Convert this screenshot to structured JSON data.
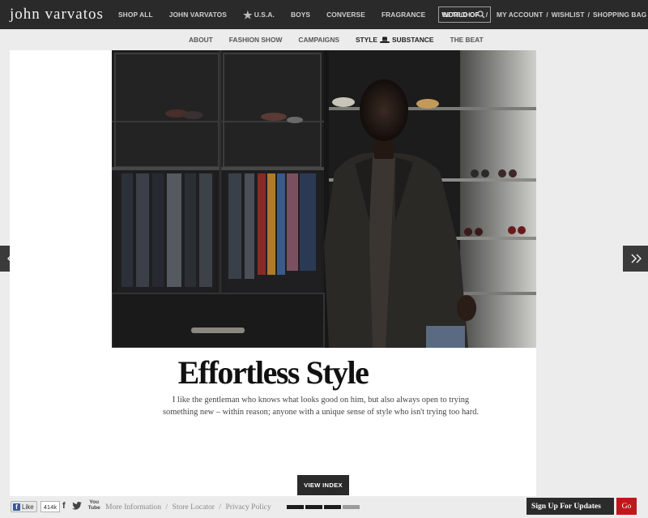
{
  "header": {
    "logo": "john varvatos",
    "nav_left": [
      {
        "label": "SHOP ALL"
      },
      {
        "label": "JOHN VARVATOS"
      },
      {
        "label": "U.S.A."
      },
      {
        "label": "BOYS"
      },
      {
        "label": "CONVERSE"
      },
      {
        "label": "FRAGRANCE"
      },
      {
        "label": "WORLD OF"
      }
    ],
    "slash": "/",
    "search_placeholder": "SEARCH",
    "nav_right": [
      {
        "label": "MY ACCOUNT"
      },
      {
        "label": "WISHLIST"
      },
      {
        "label": "SHOPPING BAG"
      }
    ],
    "nav_right_sep": "/"
  },
  "subnav": {
    "items": [
      {
        "label": "ABOUT"
      },
      {
        "label": "FASHION SHOW"
      },
      {
        "label": "CAMPAIGNS"
      },
      {
        "label": "STYLE",
        "label2": "SUBSTANCE"
      },
      {
        "label": "THE BEAT"
      }
    ]
  },
  "article": {
    "title": "Effortless Style",
    "quote_line1": "I like the gentleman who knows what looks good on him, but also always open to trying",
    "quote_line2": "something new – within reason; anyone with a unique sense of style who isn't trying too hard.",
    "view_index_label": "VIEW INDEX"
  },
  "footer": {
    "like_label": "Like",
    "like_count": "414k",
    "youtube_label_top": "You",
    "youtube_label_bottom": "Tube",
    "links": [
      {
        "label": "More Information"
      },
      {
        "label": "Store Locator"
      },
      {
        "label": "Privacy Policy"
      }
    ],
    "links_sep": "/",
    "slides_total": 4,
    "slides_active": 3,
    "signup_label": "Sign Up For Updates",
    "go_label": "Go"
  },
  "colors": {
    "topbar": "#2a2a2a",
    "accent_red": "#c0171b",
    "background": "#ececec"
  }
}
